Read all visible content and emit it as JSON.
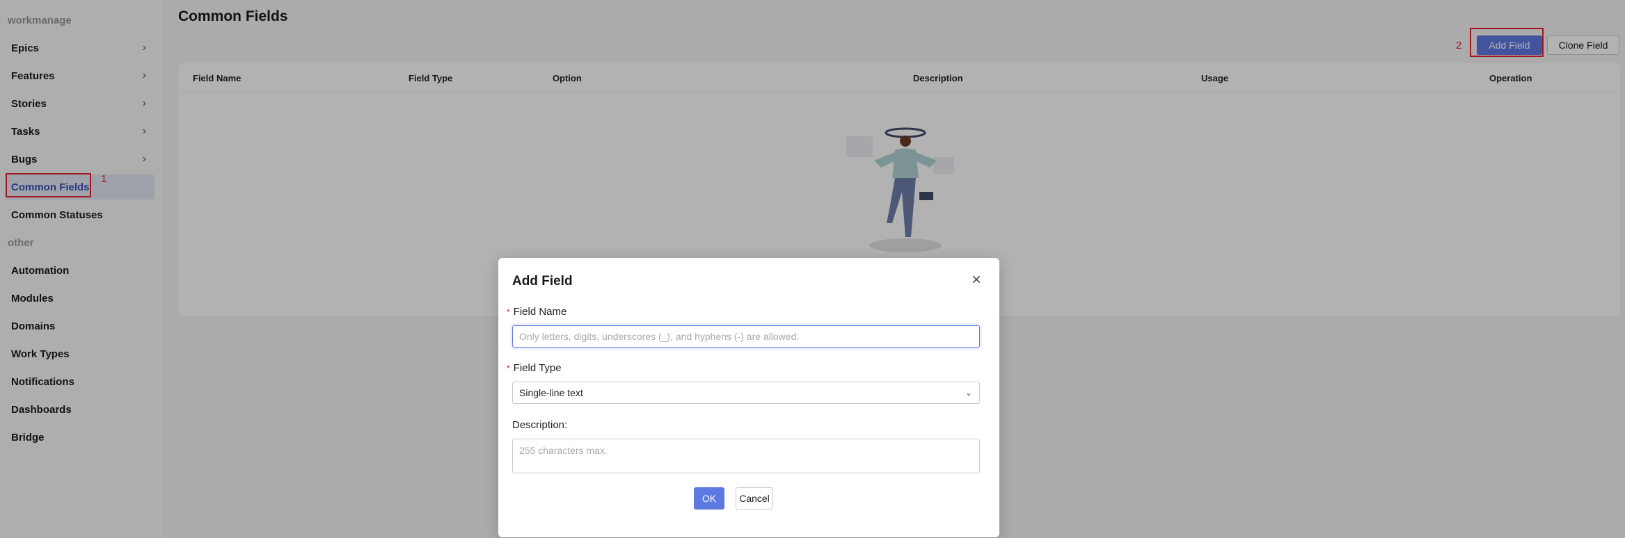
{
  "sidebar": {
    "group1": "workmanage",
    "group2": "other",
    "items1": [
      {
        "label": "Epics"
      },
      {
        "label": "Features"
      },
      {
        "label": "Stories"
      },
      {
        "label": "Tasks"
      },
      {
        "label": "Bugs"
      },
      {
        "label": "Common Fields"
      },
      {
        "label": "Common Statuses"
      }
    ],
    "items2": [
      {
        "label": "Automation"
      },
      {
        "label": "Modules"
      },
      {
        "label": "Domains"
      },
      {
        "label": "Work Types"
      },
      {
        "label": "Notifications"
      },
      {
        "label": "Dashboards"
      },
      {
        "label": "Bridge"
      }
    ],
    "chevron": "›"
  },
  "page": {
    "title": "Common Fields",
    "add_field": "Add Field",
    "clone_field": "Clone Field"
  },
  "annotations": {
    "m1": "1",
    "m2": "2"
  },
  "table": {
    "columns": [
      "Field Name",
      "Field Type",
      "Option",
      "Description",
      "Usage",
      "Operation"
    ]
  },
  "modal": {
    "title": "Add Field",
    "close": "×",
    "field_name_label": "Field Name",
    "field_name_placeholder": "Only letters, digits, underscores (_), and hyphens (-) are allowed.",
    "field_type_label": "Field Type",
    "field_type_value": "Single-line text",
    "description_label": "Description:",
    "description_placeholder": "255 characters max.",
    "ok": "OK",
    "cancel": "Cancel",
    "required": "*",
    "dropdown": "⌄"
  },
  "colors": {
    "primary": "#5e79e1",
    "annotation": "#e5202e"
  }
}
